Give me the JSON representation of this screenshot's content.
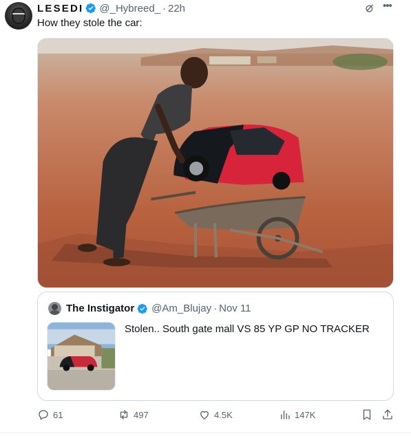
{
  "author": {
    "name": "LESEDI",
    "handle": "@_Hybreed_",
    "separator": "·",
    "time": "22h",
    "verified": true
  },
  "tweet": {
    "text": "How they stole the car:"
  },
  "quote": {
    "name": "The Instigator",
    "handle": "@Am_Blujay",
    "separator": "·",
    "date": "Nov 11",
    "verified": true,
    "text": "Stolen.. South gate mall VS 85 YP GP NO TRACKER"
  },
  "actions": {
    "replies": "61",
    "reposts": "497",
    "likes": "4.5K",
    "views": "147K"
  },
  "icons": {
    "verified": "verified-badge-icon",
    "grok": "grok-icon",
    "more": "more-icon",
    "reply": "reply-icon",
    "repost": "repost-icon",
    "like": "heart-icon",
    "views": "views-icon",
    "bookmark": "bookmark-icon",
    "share": "share-icon"
  },
  "colors": {
    "verified_blue": "#1d9bf0",
    "secondary_text": "#536471",
    "car_red": "#d8243a"
  }
}
